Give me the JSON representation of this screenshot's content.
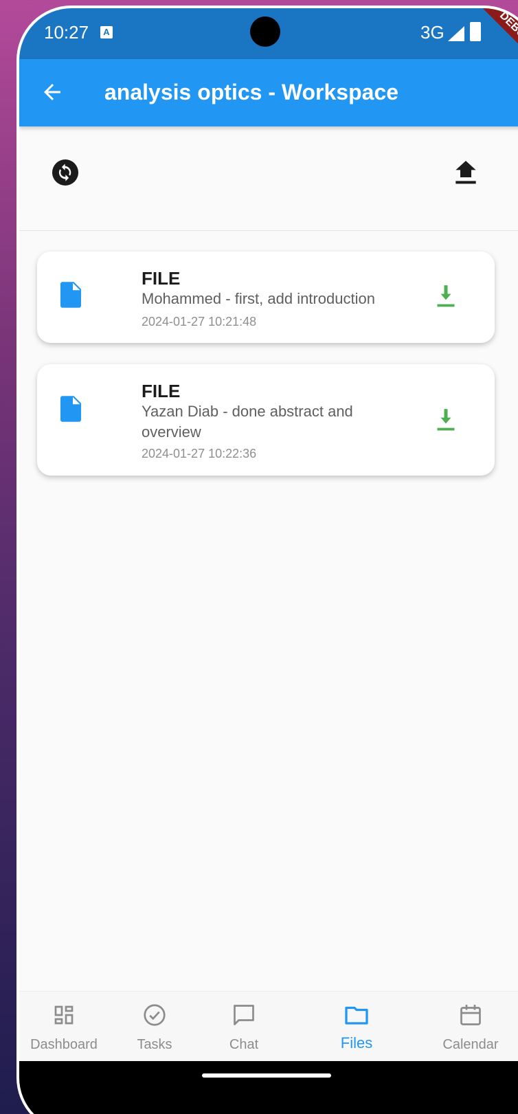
{
  "status_bar": {
    "time": "10:27",
    "network": "3G",
    "debug_label": "DEBUG"
  },
  "app_bar": {
    "title": "analysis optics - Workspace"
  },
  "toolbar": {
    "left_icon": "sync-icon",
    "right_icon": "upload-icon"
  },
  "files": [
    {
      "type": "FILE",
      "description": "Mohammed - first, add introduction",
      "date": "2024-01-27 10:21:48"
    },
    {
      "type": "FILE",
      "description": "Yazan Diab - done abstract and overview",
      "date": "2024-01-27 10:22:36"
    }
  ],
  "bottom_nav": {
    "items": [
      {
        "label": "Dashboard",
        "icon": "dashboard-icon"
      },
      {
        "label": "Tasks",
        "icon": "check-circle-icon"
      },
      {
        "label": "Chat",
        "icon": "chat-bubble-icon"
      },
      {
        "label": "Files",
        "icon": "folder-icon",
        "active": true
      },
      {
        "label": "Calendar",
        "icon": "calendar-icon"
      }
    ]
  },
  "colors": {
    "primary": "#2196f3",
    "status_bar": "#1a76c2",
    "download_green": "#4caf50",
    "debug_red": "#8b1a1a"
  }
}
